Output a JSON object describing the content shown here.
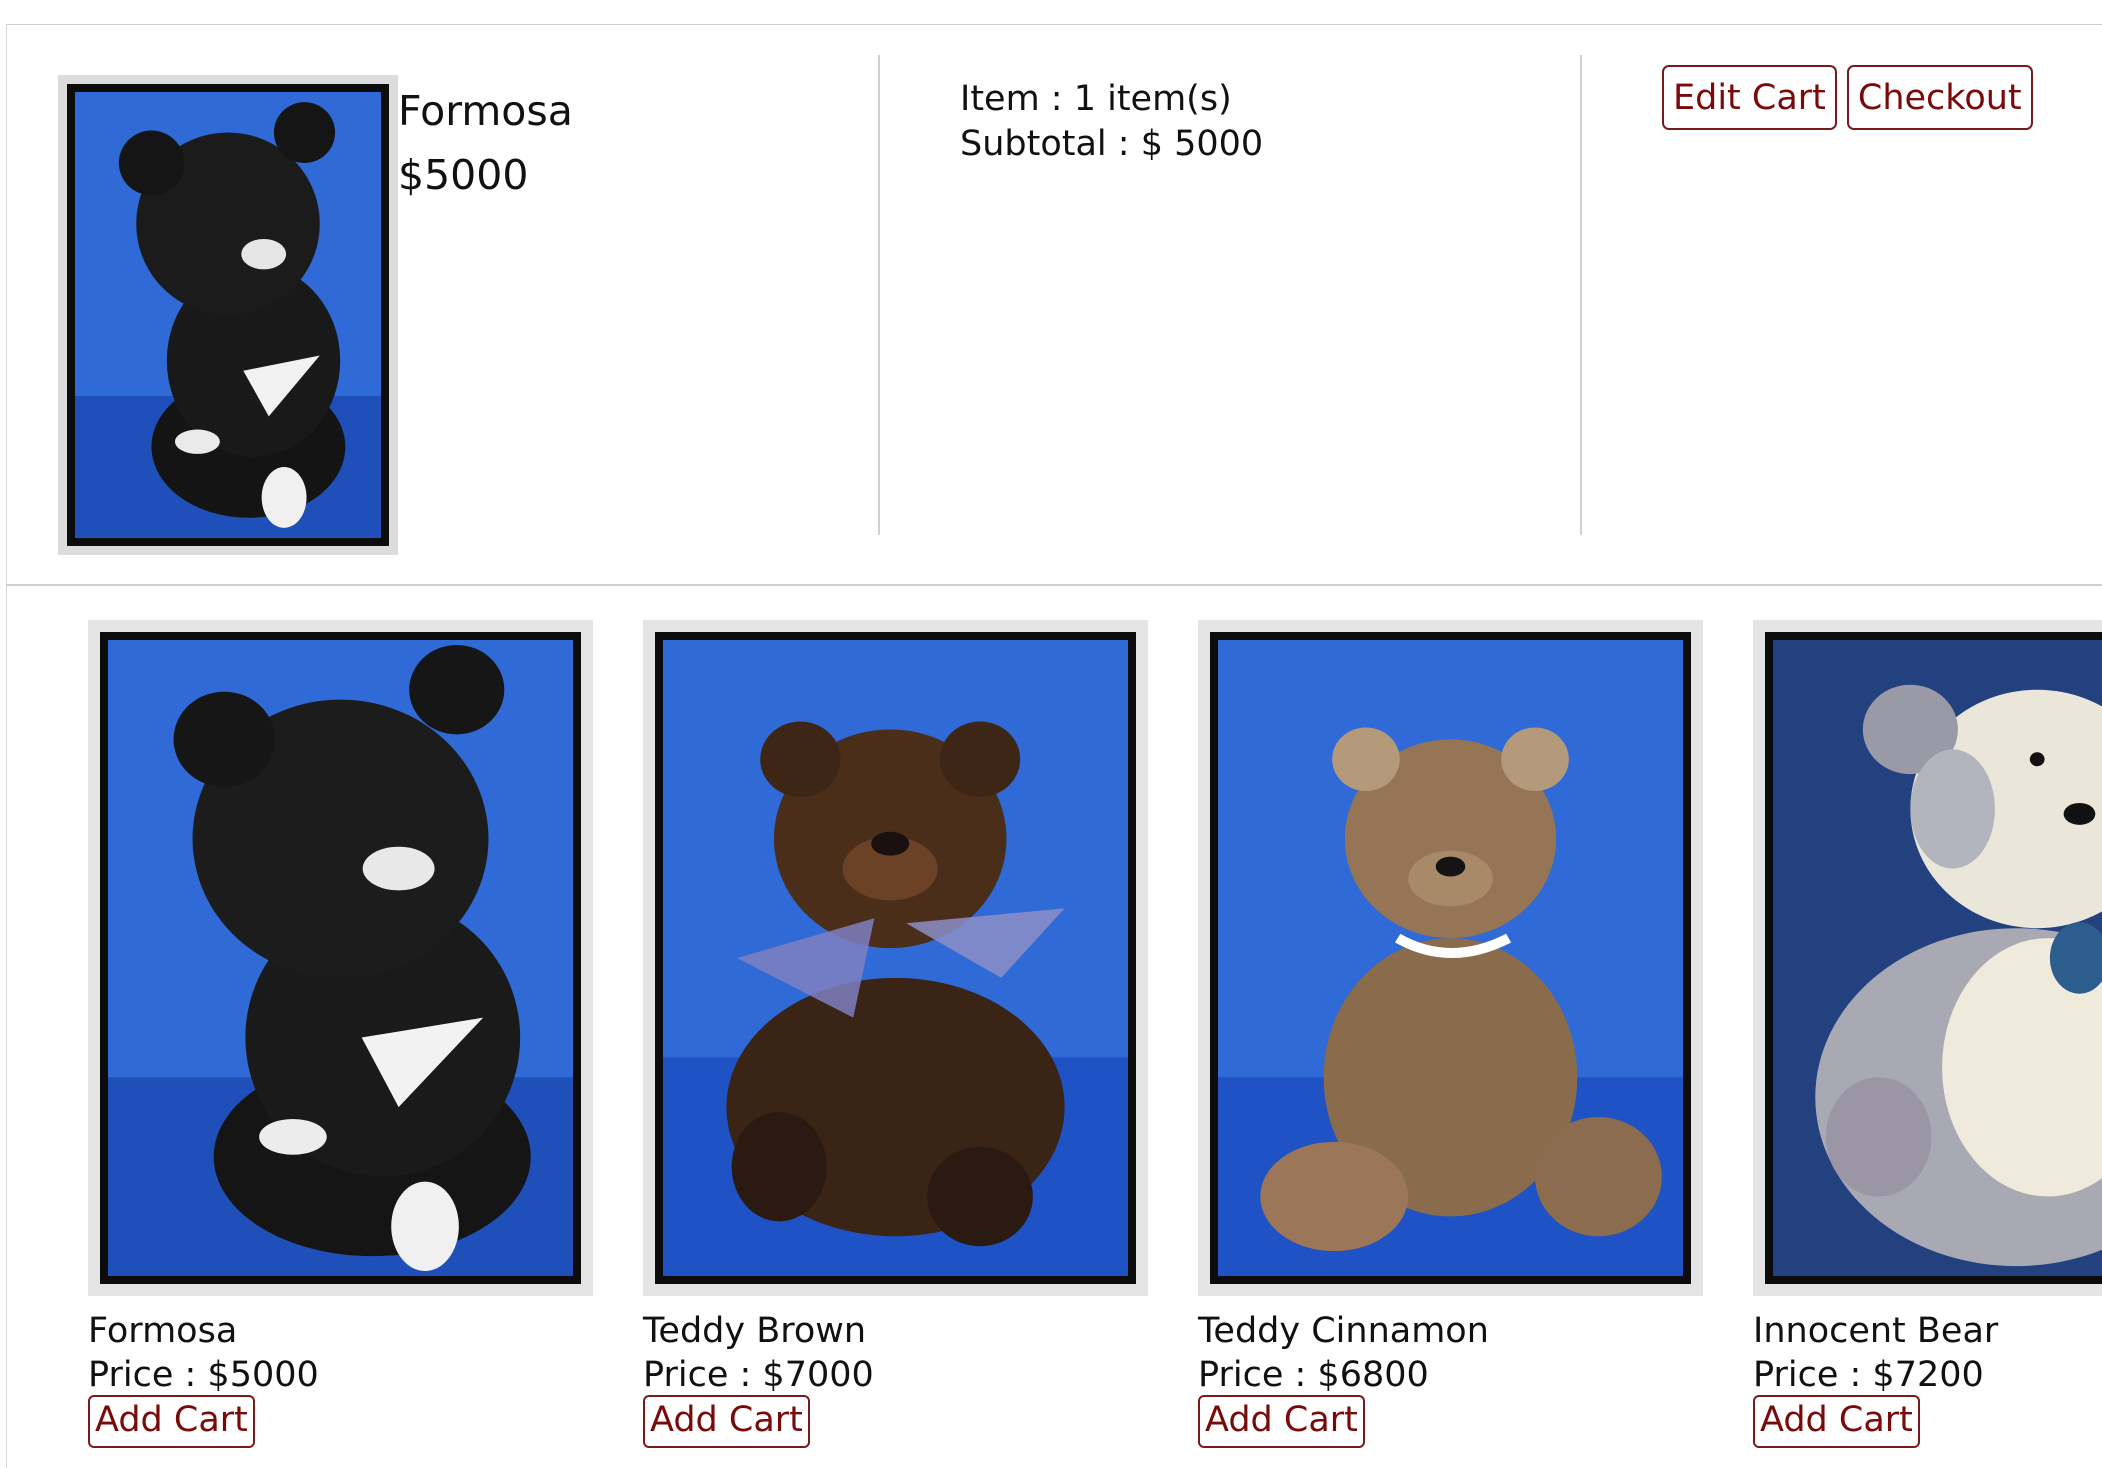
{
  "colors": {
    "accent": "#7a0a0a",
    "photo_backdrop": "#2c66d4",
    "photo_frame": "#0c0c0c"
  },
  "cart_summary": {
    "product_name": "Formosa",
    "product_price": "$5000",
    "item_line": "Item : 1 item(s)",
    "subtotal_line": "Subtotal : $ 5000",
    "edit_cart_label": "Edit Cart",
    "checkout_label": "Checkout"
  },
  "products": [
    {
      "name": "Formosa",
      "price": "Price : $5000",
      "add_label": "Add Cart"
    },
    {
      "name": "Teddy Brown",
      "price": "Price : $7000",
      "add_label": "Add Cart"
    },
    {
      "name": "Teddy Cinnamon",
      "price": "Price : $6800",
      "add_label": "Add Cart"
    },
    {
      "name": "Innocent Bear",
      "price": "Price : $7200",
      "add_label": "Add Cart"
    }
  ]
}
